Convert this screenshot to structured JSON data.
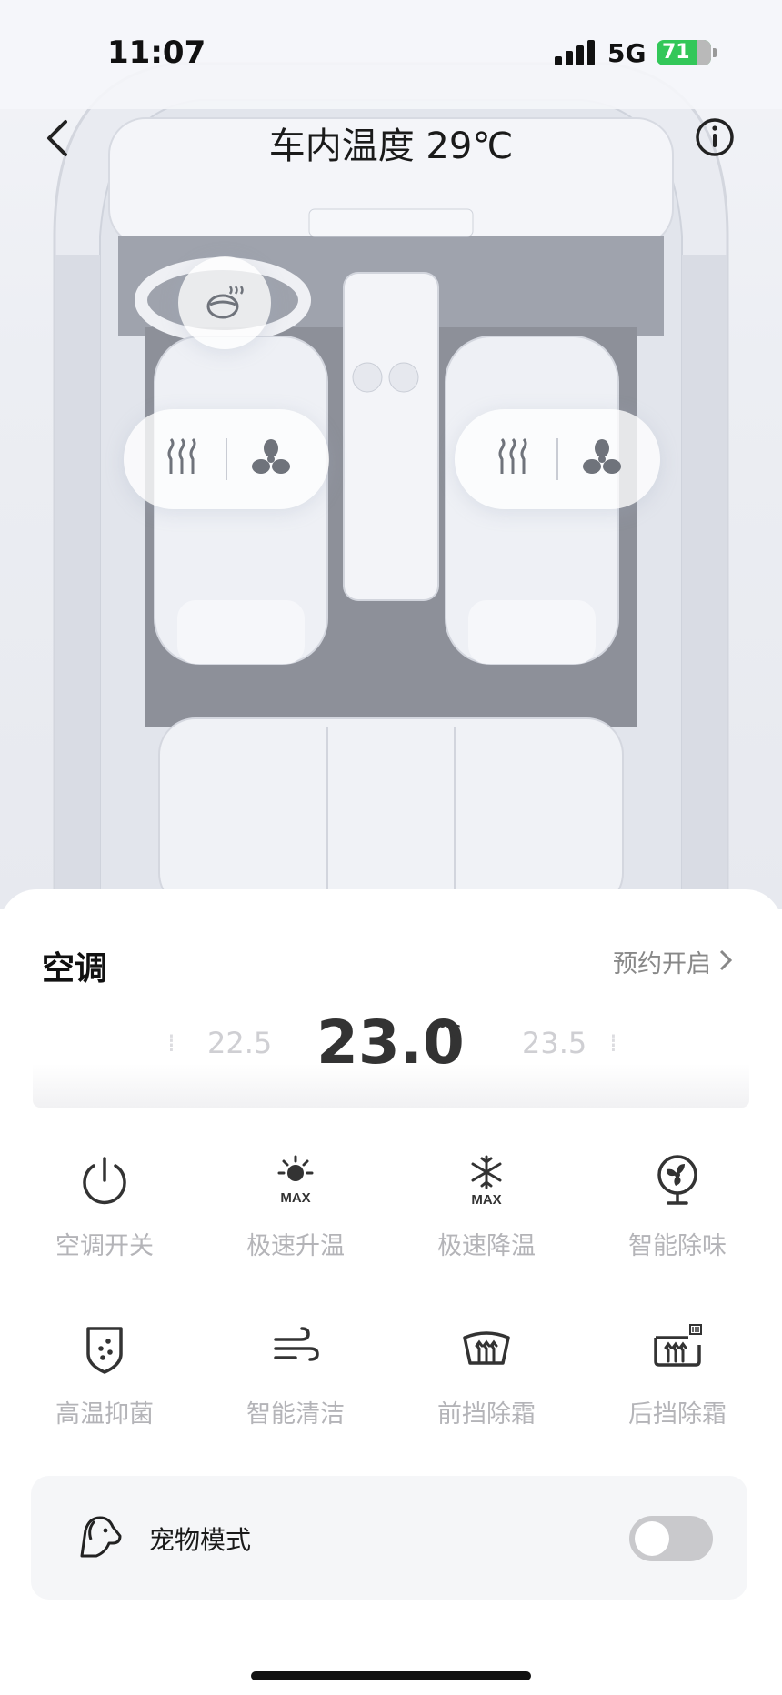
{
  "status_bar": {
    "time": "11:07",
    "network": "5G",
    "battery": "71"
  },
  "header": {
    "title": "车内温度 29℃"
  },
  "icons": {
    "back": "chevron-left-icon",
    "info": "info-icon",
    "steering_heat": "steering-wheel-heat-icon",
    "seat_heat": "seat-heat-icon",
    "seat_fan": "fan-icon"
  },
  "ac": {
    "section_title": "空调",
    "schedule_label": "预约开启",
    "temp_prev": "22.5",
    "temp_current": "23.0",
    "temp_next": "23.5",
    "temp_unit": "°c",
    "controls": [
      {
        "label": "空调开关",
        "icon": "power-icon"
      },
      {
        "label": "极速升温",
        "icon": "sun-max-icon"
      },
      {
        "label": "极速降温",
        "icon": "snowflake-max-icon"
      },
      {
        "label": "智能除味",
        "icon": "purifier-fan-icon"
      },
      {
        "label": "高温抑菌",
        "icon": "shield-dots-icon"
      },
      {
        "label": "智能清洁",
        "icon": "wind-icon"
      },
      {
        "label": "前挡除霜",
        "icon": "front-defrost-icon"
      },
      {
        "label": "后挡除霜",
        "icon": "rear-defrost-icon"
      }
    ]
  },
  "pet_mode": {
    "label": "宠物模式",
    "enabled": false
  },
  "colors": {
    "battery": "#33c759",
    "toggle_off": "#c9c9cc",
    "label_gray": "#b4b4b8"
  }
}
